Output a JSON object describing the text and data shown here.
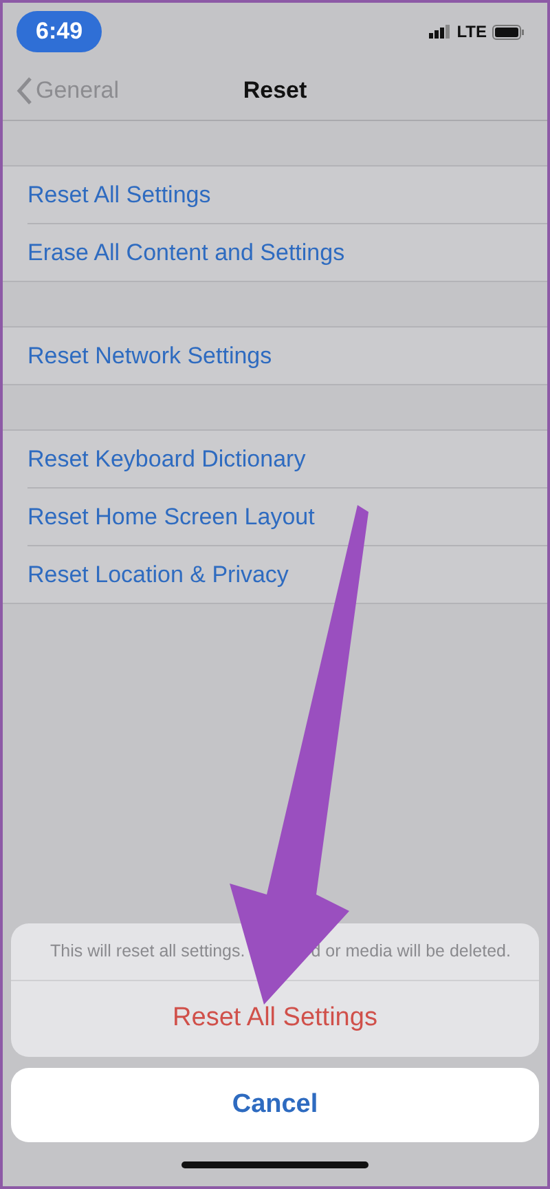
{
  "status_bar": {
    "time": "6:49",
    "network": "LTE"
  },
  "nav": {
    "back": "General",
    "title": "Reset"
  },
  "groups": [
    {
      "items": [
        "Reset All Settings",
        "Erase All Content and Settings"
      ]
    },
    {
      "items": [
        "Reset Network Settings"
      ]
    },
    {
      "items": [
        "Reset Keyboard Dictionary",
        "Reset Home Screen Layout",
        "Reset Location & Privacy"
      ]
    }
  ],
  "action_sheet": {
    "message_parts": [
      "This will reset all settings.",
      "d or media will be deleted."
    ],
    "destructive_action": "Reset All Settings",
    "cancel": "Cancel"
  }
}
